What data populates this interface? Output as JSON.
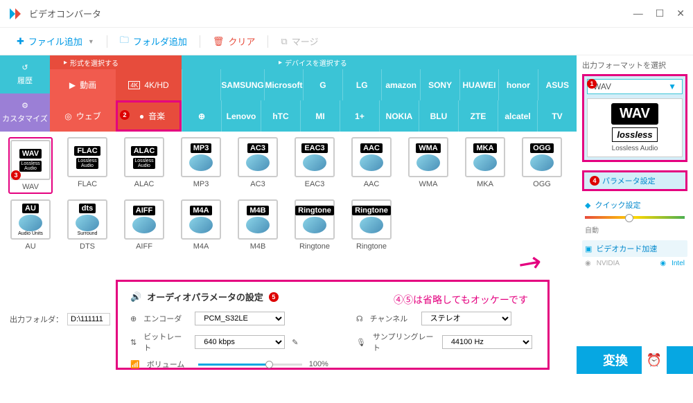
{
  "titlebar": {
    "title": "ビデオコンバータ"
  },
  "toolbar": {
    "add_file": "ファイル追加",
    "add_folder": "フォルダ追加",
    "clear": "クリア",
    "merge": "マージ"
  },
  "side_tabs": {
    "history": "履歴",
    "customize": "カスタマイズ"
  },
  "cat_headers": {
    "format": "形式を選択する",
    "device": "デバイスを選択する"
  },
  "cats": {
    "video": "動画",
    "hd": "4K/HD",
    "web": "ウェブ",
    "music": "音楽"
  },
  "brands": [
    "",
    "SAMSUNG",
    "Microsoft",
    "G",
    "LG",
    "amazon",
    "SONY",
    "HUAWEI",
    "honor",
    "ASUS",
    "",
    "Lenovo",
    "hTC",
    "MI",
    "1+",
    "NOKIA",
    "BLU",
    "ZTE",
    "alcatel",
    "TV"
  ],
  "formats_row1": [
    {
      "code": "WAV",
      "label": "WAV",
      "lossless": true
    },
    {
      "code": "FLAC",
      "label": "FLAC",
      "lossless": true
    },
    {
      "code": "ALAC",
      "label": "ALAC",
      "lossless": true
    },
    {
      "code": "MP3",
      "label": "MP3"
    },
    {
      "code": "AC3",
      "label": "AC3"
    },
    {
      "code": "EAC3",
      "label": "EAC3"
    },
    {
      "code": "AAC",
      "label": "AAC"
    },
    {
      "code": "WMA",
      "label": "WMA"
    },
    {
      "code": "MKA",
      "label": "MKA"
    },
    {
      "code": "OGG",
      "label": "OGG"
    }
  ],
  "formats_row2": [
    {
      "code": "AU",
      "label": "AU",
      "sub": "Audio Units"
    },
    {
      "code": "dts",
      "label": "DTS",
      "sub": "Surround"
    },
    {
      "code": "AIFF",
      "label": "AIFF"
    },
    {
      "code": "M4A",
      "label": "M4A"
    },
    {
      "code": "M4B",
      "label": "M4B"
    },
    {
      "code": "Ringtone",
      "label": "Ringtone",
      "apple": true
    },
    {
      "code": "Ringtone",
      "label": "Ringtone",
      "android": true
    }
  ],
  "right": {
    "header": "出力フォーマットを選択",
    "selected": "WAV",
    "preview_big": "WAV",
    "preview_los": "lossless",
    "preview_sub": "Lossless Audio",
    "param": "パラメータ設定",
    "quick": "クイック設定",
    "auto": "自動",
    "gpu": "ビデオカード加速",
    "nvidia": "NVIDIA",
    "intel": "Intel",
    "convert": "変換"
  },
  "audio": {
    "title": "オーディオパラメータの設定",
    "encoder_lbl": "エンコーダ",
    "encoder_val": "PCM_S32LE",
    "bitrate_lbl": "ビットレート",
    "bitrate_val": "640 kbps",
    "volume_lbl": "ボリューム",
    "volume_val": "100%",
    "channel_lbl": "チャンネル",
    "channel_val": "ステレオ",
    "sample_lbl": "サンプリングレート",
    "sample_val": "44100 Hz",
    "note": "④⑤は省略してもオッケーです"
  },
  "output": {
    "label": "出力フォルダ：",
    "value": "D:\\111111"
  },
  "badges": {
    "b1": "1",
    "b2": "2",
    "b3": "3",
    "b4": "4",
    "b5": "5"
  }
}
